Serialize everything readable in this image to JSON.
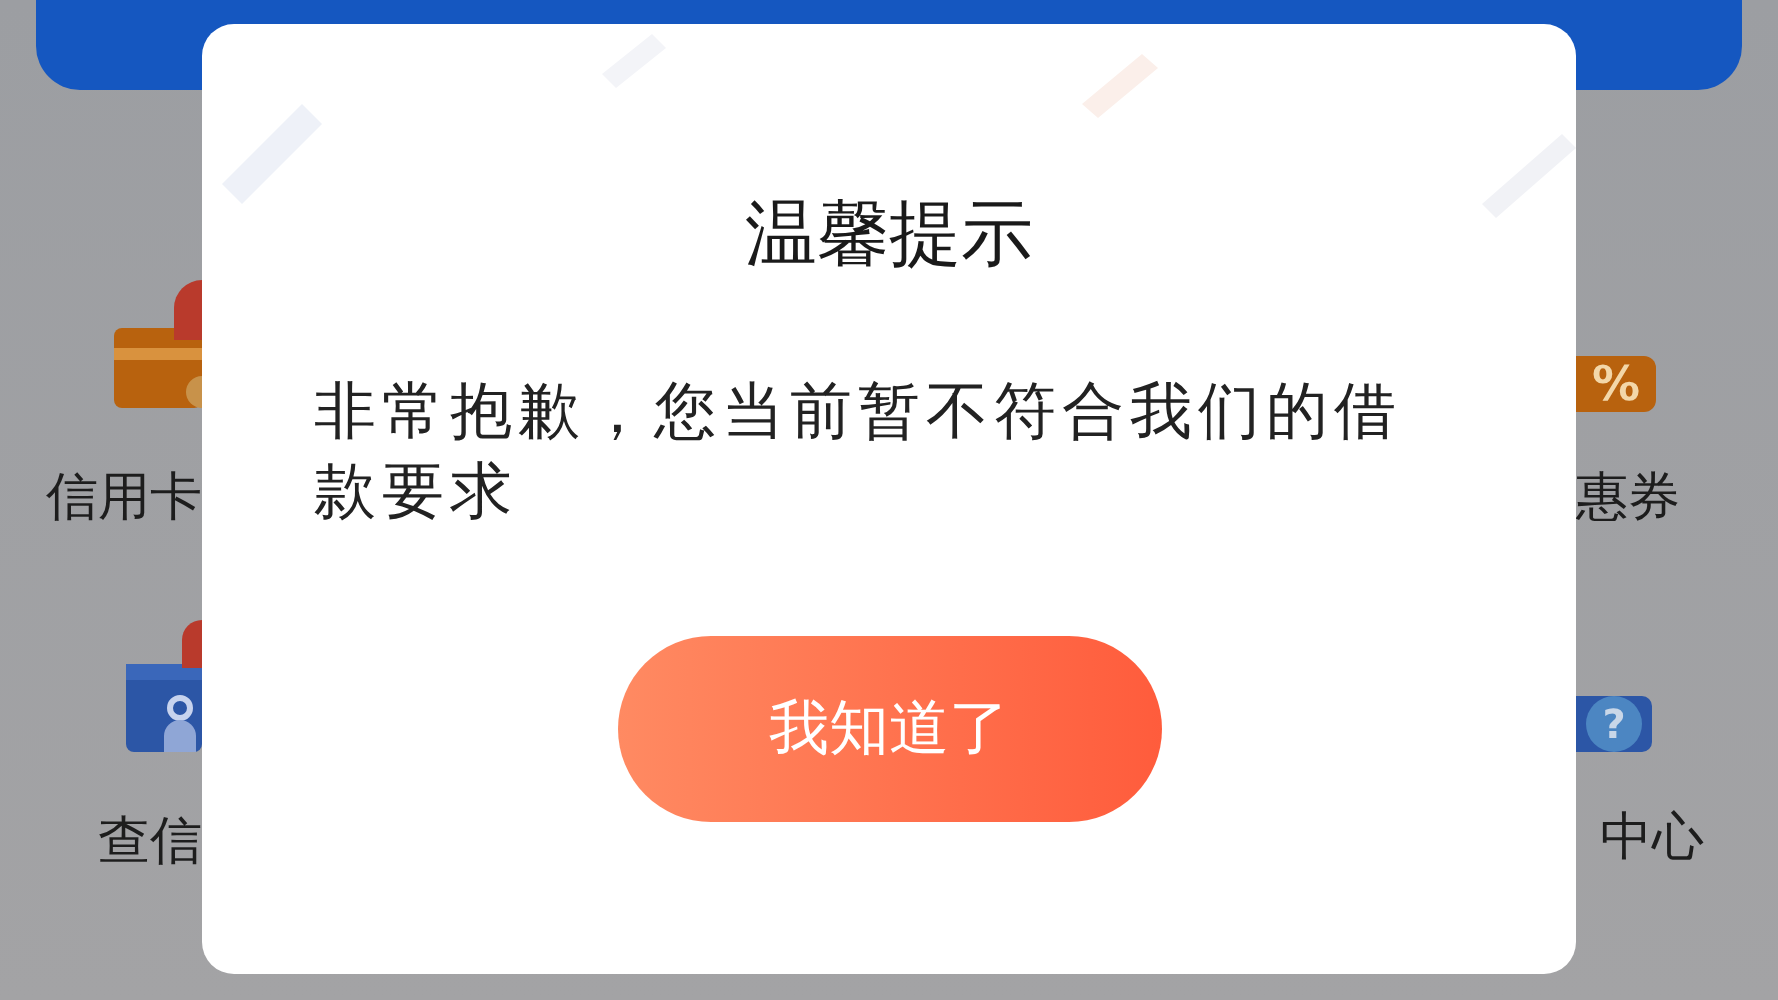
{
  "background": {
    "left_items": [
      {
        "label": "信用卡",
        "kind": "card"
      },
      {
        "label": "查信",
        "kind": "id"
      }
    ],
    "right_items": [
      {
        "label": "惠券",
        "kind": "ticket",
        "glyph": "%"
      },
      {
        "label": "中心",
        "kind": "help",
        "glyph": "?"
      }
    ]
  },
  "dialog": {
    "title": "温馨提示",
    "message": "非常抱歉，您当前暂不符合我们的借款要求",
    "button": "我知道了"
  }
}
